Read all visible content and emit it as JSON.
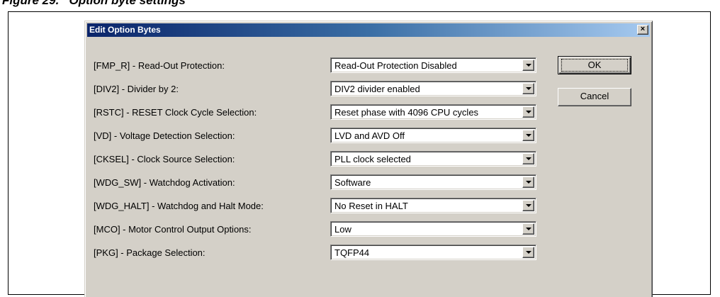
{
  "figure": {
    "caption": "Figure 29.   Option byte settings"
  },
  "dialog": {
    "title": "Edit Option Bytes",
    "close_label": "×",
    "buttons": {
      "ok": "OK",
      "cancel": "Cancel"
    },
    "rows": [
      {
        "label": "[FMP_R] - Read-Out Protection:",
        "value": "Read-Out Protection Disabled"
      },
      {
        "label": "[DIV2] - Divider by 2:",
        "value": "DIV2 divider enabled"
      },
      {
        "label": "[RSTC] - RESET Clock Cycle Selection:",
        "value": "Reset phase with 4096 CPU cycles"
      },
      {
        "label": "[VD] - Voltage Detection Selection:",
        "value": "LVD and AVD Off"
      },
      {
        "label": "[CKSEL] - Clock Source Selection:",
        "value": "PLL clock selected"
      },
      {
        "label": "[WDG_SW] - Watchdog Activation:",
        "value": "Software"
      },
      {
        "label": "[WDG_HALT] - Watchdog and Halt Mode:",
        "value": "No Reset in HALT"
      },
      {
        "label": "[MCO] - Motor Control Output Options:",
        "value": "Low"
      },
      {
        "label": "[PKG] - Package Selection:",
        "value": "TQFP44"
      }
    ]
  },
  "colors": {
    "titlebar_start": "#0a246a",
    "titlebar_end": "#a6caf0",
    "dialog_face": "#d4d0c8"
  }
}
